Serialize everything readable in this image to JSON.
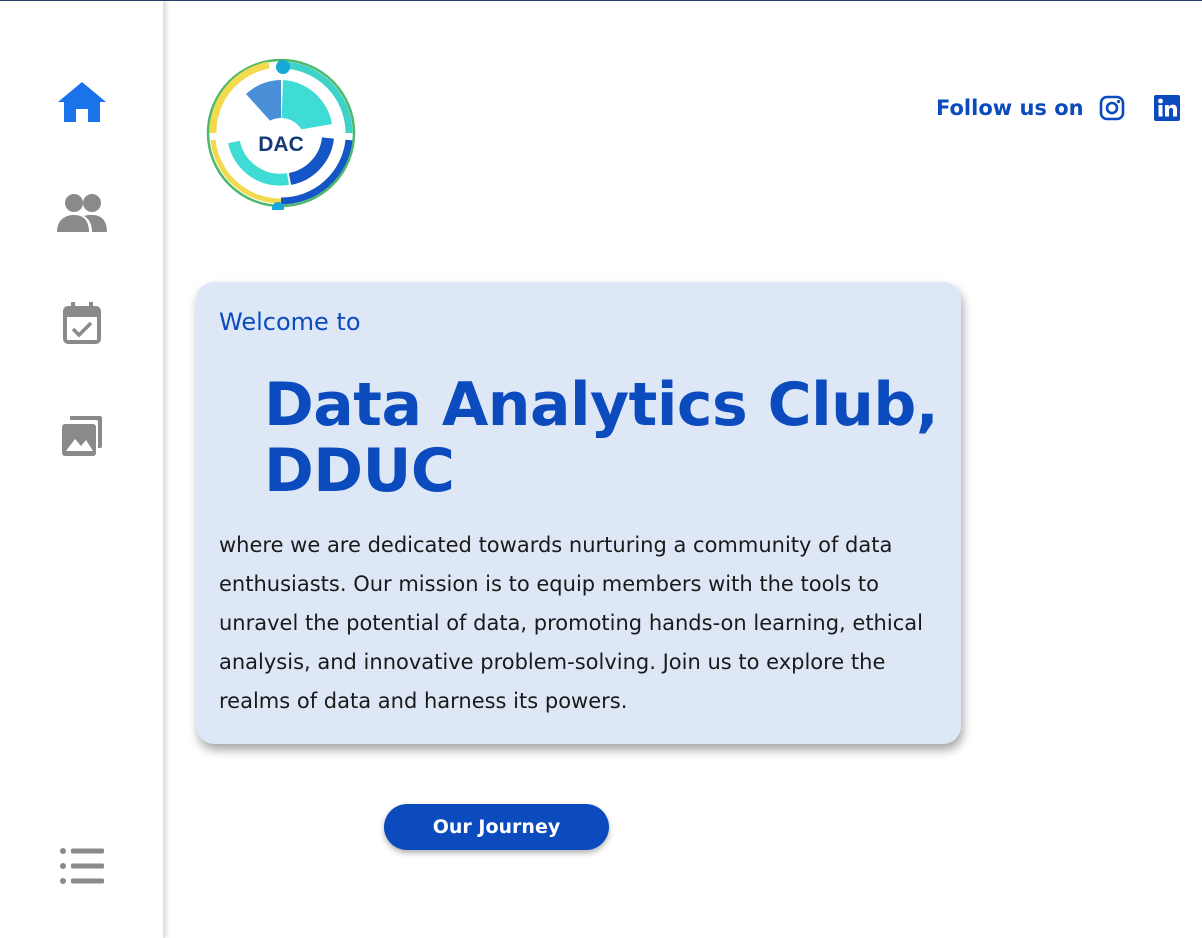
{
  "sidebar": {
    "items": [
      {
        "name": "home-icon",
        "color": "#1a73e8"
      },
      {
        "name": "group-icon",
        "color": "#8a8a8a"
      },
      {
        "name": "calendar-check-icon",
        "color": "#8a8a8a"
      },
      {
        "name": "photo-gallery-icon",
        "color": "#8a8a8a"
      },
      {
        "name": "menu-list-icon",
        "color": "#8a8a8a"
      }
    ]
  },
  "logo": {
    "text": "DAC"
  },
  "header": {
    "follow_label": "Follow us on",
    "social": [
      {
        "name": "instagram-icon"
      },
      {
        "name": "linkedin-icon"
      }
    ]
  },
  "hero": {
    "welcome": "Welcome to",
    "title": "Data Analytics Club, DDUC",
    "description": "where we are dedicated towards nurturing a community of data enthusiasts. Our mission is to equip members with the tools to unravel the potential of data, promoting hands-on learning, ethical analysis, and innovative problem-solving. Join us to explore the realms of data and harness its powers."
  },
  "cta": {
    "label": "Our Journey"
  },
  "colors": {
    "brand": "#0b4bbd",
    "card_bg": "#dee7f6",
    "active_icon": "#1a73e8",
    "inactive_icon": "#8a8a8a"
  }
}
